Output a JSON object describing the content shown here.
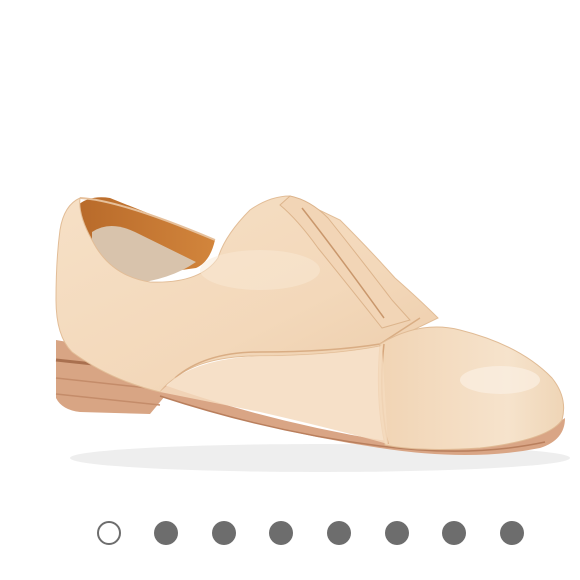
{
  "gallery": {
    "product_image_icon": "loafer-shoe-image",
    "dots_total": 8,
    "active_index": 0
  },
  "colors": {
    "leather": "#f5dcc0",
    "lining": "#c0732f",
    "sole": "#d9a585",
    "dot_inactive": "#6d6d6d"
  }
}
